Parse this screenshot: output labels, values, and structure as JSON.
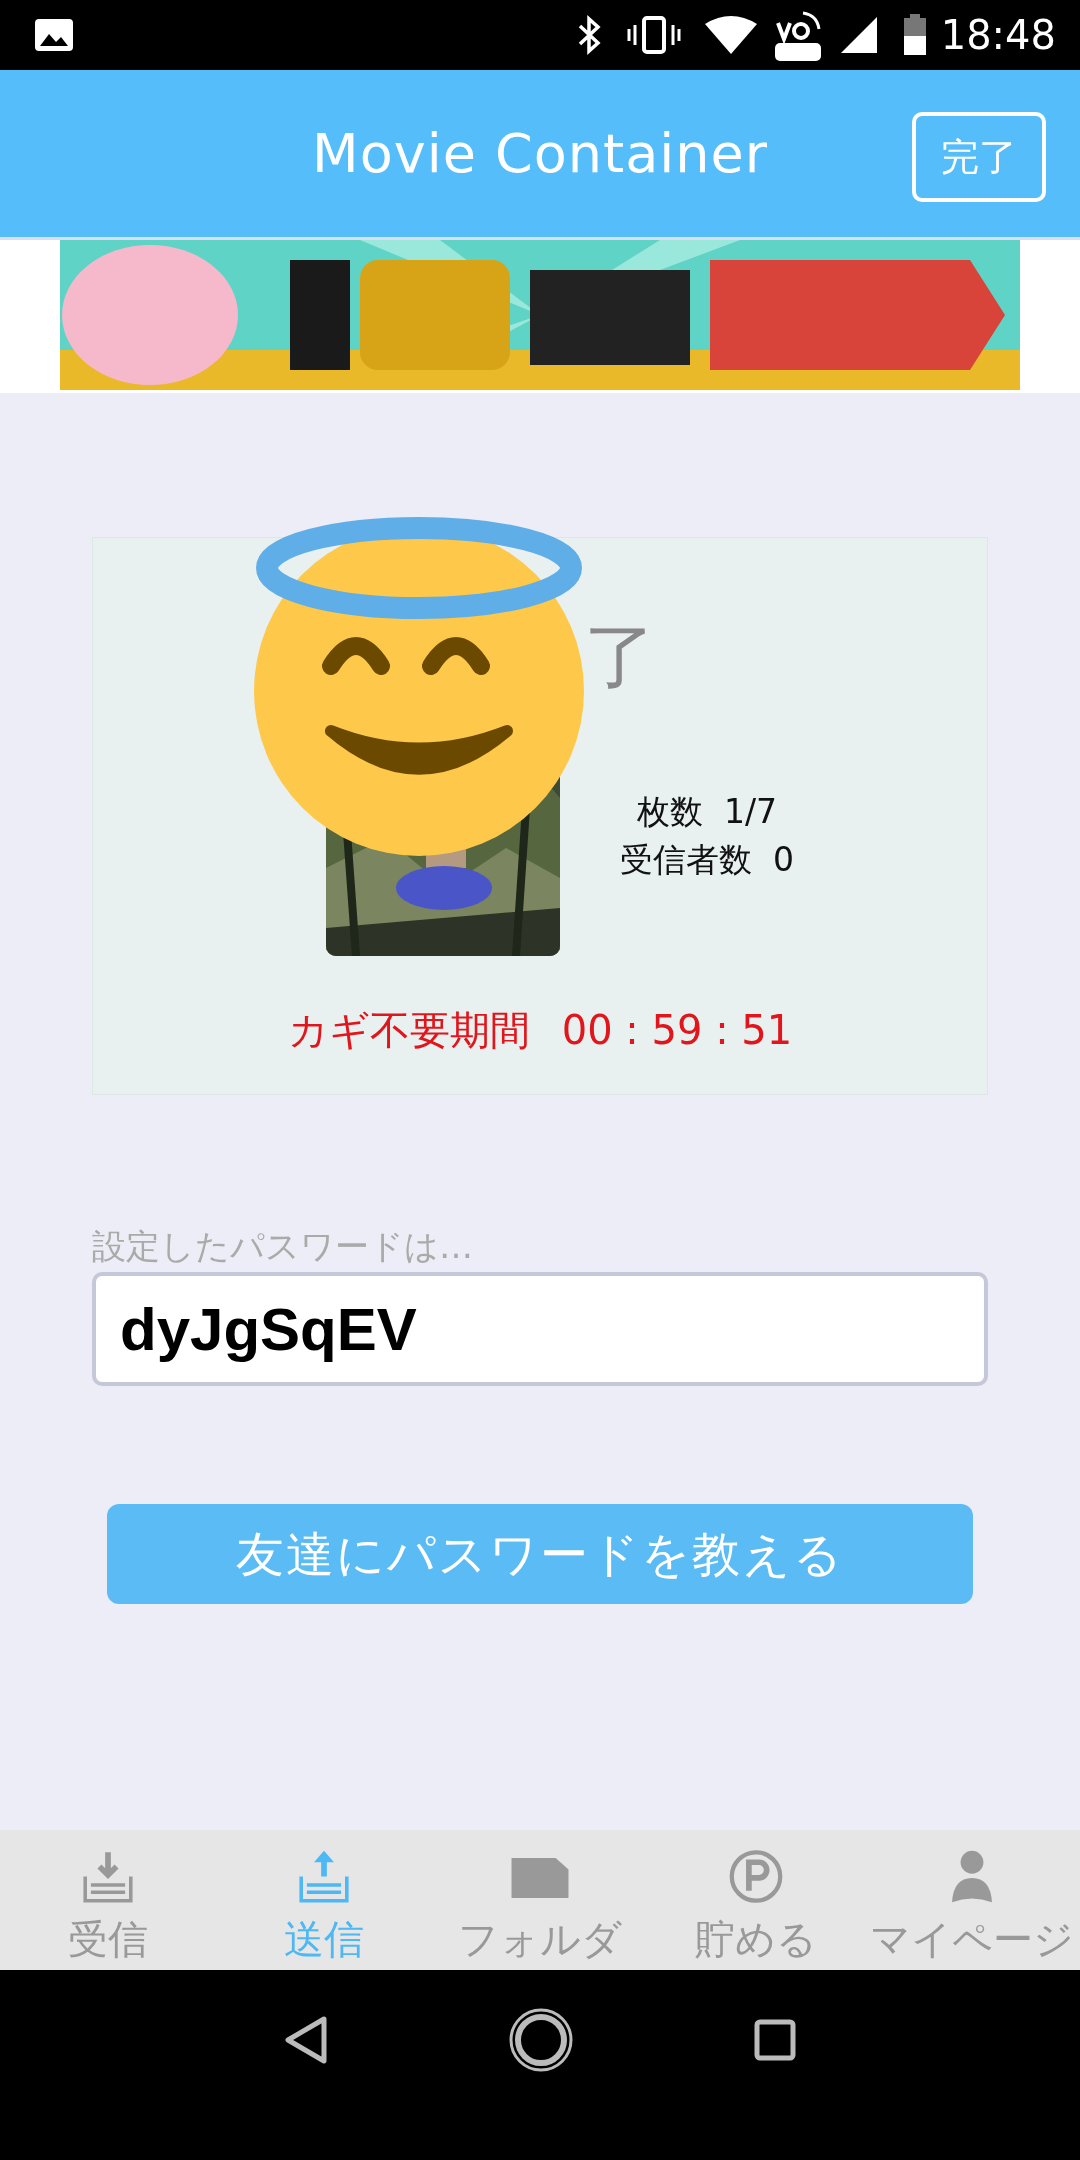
{
  "status_bar": {
    "time": "18:48"
  },
  "header": {
    "title": "Movie Container",
    "done_button": "完了"
  },
  "card": {
    "title": "了",
    "stats": [
      "枚数  1/7",
      "受信者数  0"
    ],
    "timer_label": "カギ不要期間",
    "timer": "00 : 59 : 51"
  },
  "password": {
    "label": "設定したパスワードは…",
    "value": "dyJgSqEV"
  },
  "share_button": "友達にパスワードを教える",
  "tabs": [
    {
      "label": "受信",
      "selected": false
    },
    {
      "label": "送信",
      "selected": true
    },
    {
      "label": "フォルダ",
      "selected": false
    },
    {
      "label": "貯める",
      "selected": false
    },
    {
      "label": "マイページ",
      "selected": false
    }
  ]
}
